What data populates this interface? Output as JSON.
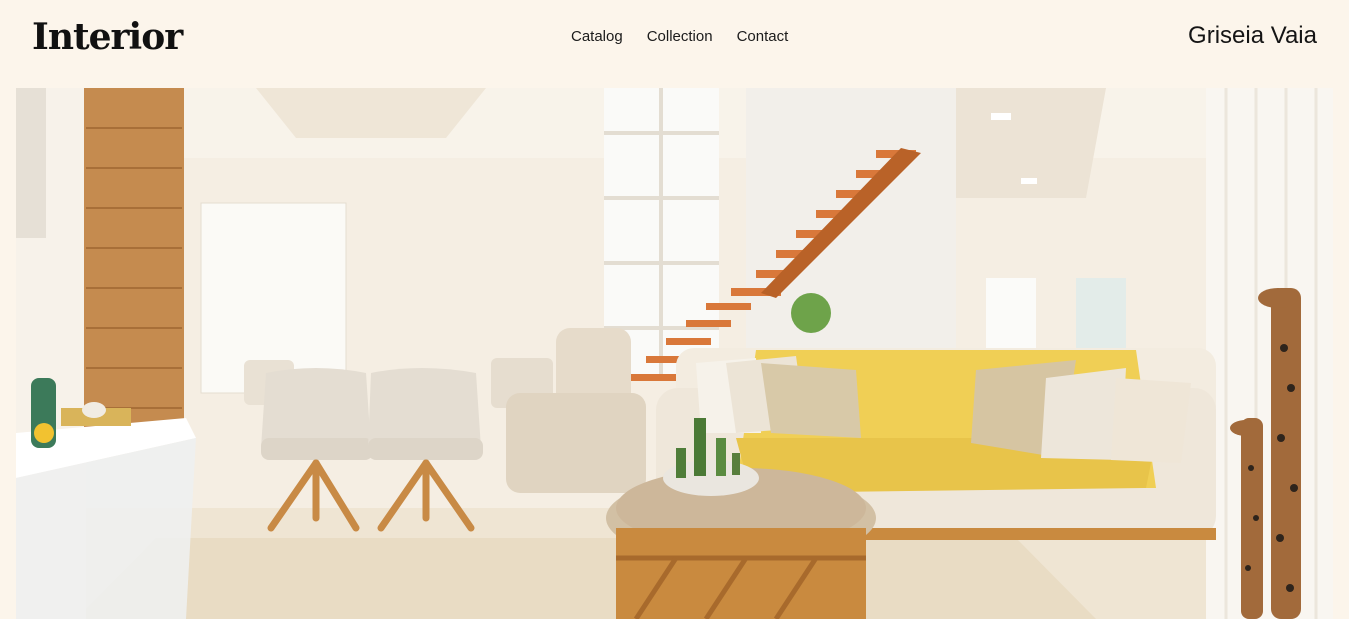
{
  "header": {
    "logo": "Interior",
    "nav": [
      {
        "label": "Catalog"
      },
      {
        "label": "Collection"
      },
      {
        "label": "Contact"
      }
    ],
    "brand_right": "Griseia Vaia"
  },
  "hero": {
    "image_icon": "living-room-photo",
    "colors": {
      "wall": "#f3ebdd",
      "sofa_throw": "#f0cf55",
      "wood": "#c98a3f",
      "stairs": "#d9783a"
    }
  }
}
